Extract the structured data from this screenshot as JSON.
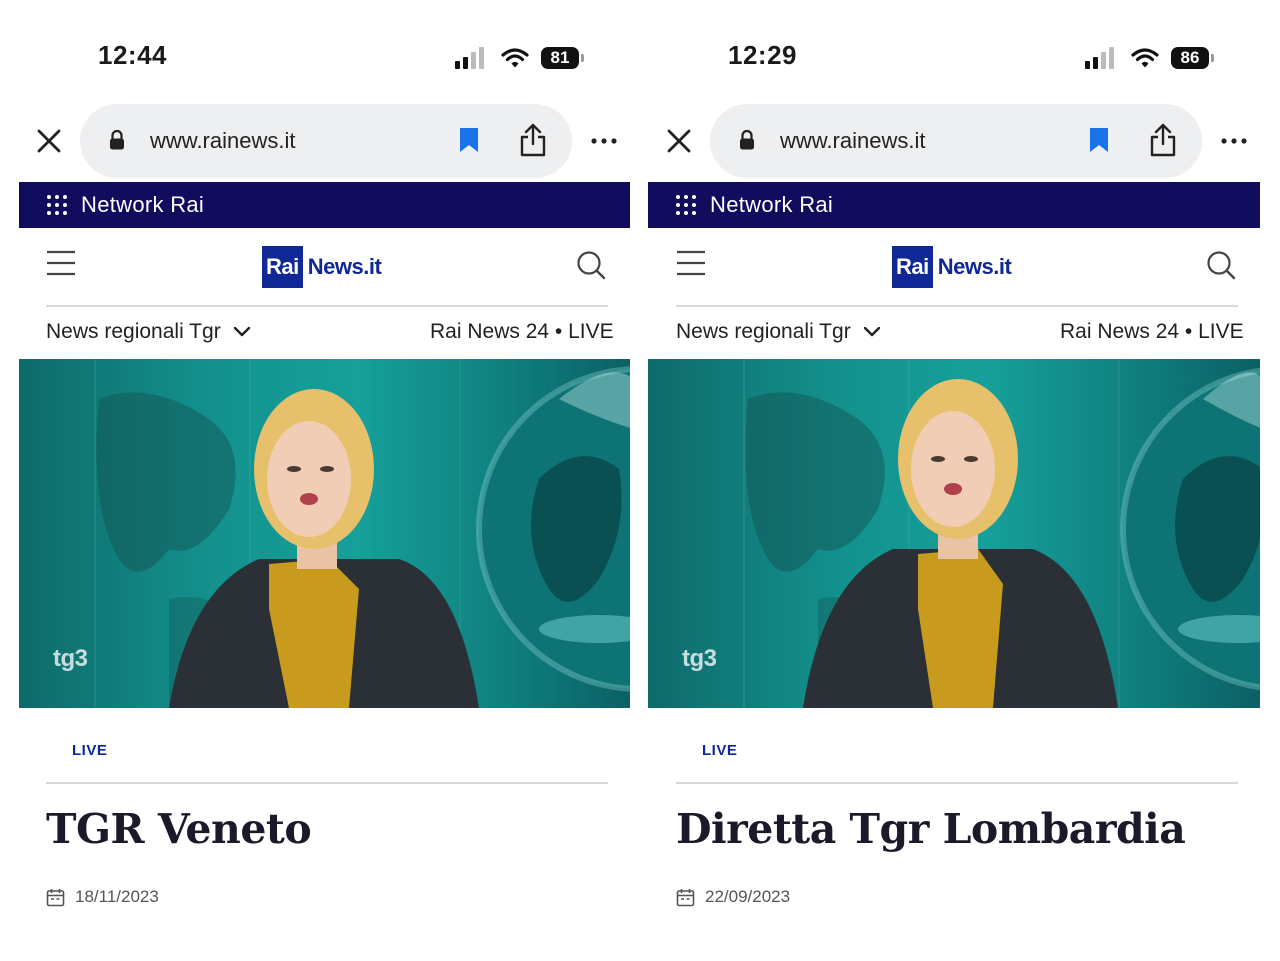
{
  "screens": [
    {
      "status_time": "12:44",
      "battery": "81",
      "url": "www.rainews.it",
      "network_label": "Network Rai",
      "logo": {
        "rai": "Rai",
        "news": "News.it"
      },
      "subnav_left": "News regionali Tgr",
      "subnav_right": "Rai News 24 • LIVE",
      "video_watermark": "tg3",
      "tag": "LIVE",
      "headline": "TGR Veneto",
      "date": "18/11/2023"
    },
    {
      "status_time": "12:29",
      "battery": "86",
      "url": "www.rainews.it",
      "network_label": "Network Rai",
      "logo": {
        "rai": "Rai",
        "news": "News.it"
      },
      "subnav_left": "News regionali Tgr",
      "subnav_right": "Rai News 24 • LIVE",
      "video_watermark": "tg3",
      "tag": "LIVE",
      "headline": "Diretta Tgr Lombardia",
      "date": "22/09/2023"
    }
  ],
  "colors": {
    "network_bar": "#110c5e",
    "brand_blue": "#102896",
    "bookmark_blue": "#1a73e8",
    "video_teal": "#13908c"
  },
  "icons": [
    "close-icon",
    "lock-icon",
    "bookmark-icon",
    "share-icon",
    "more-icon",
    "grid-icon",
    "hamburger-icon",
    "search-icon",
    "chevron-down-icon",
    "calendar-icon",
    "signal-icon",
    "wifi-icon",
    "battery-icon"
  ]
}
